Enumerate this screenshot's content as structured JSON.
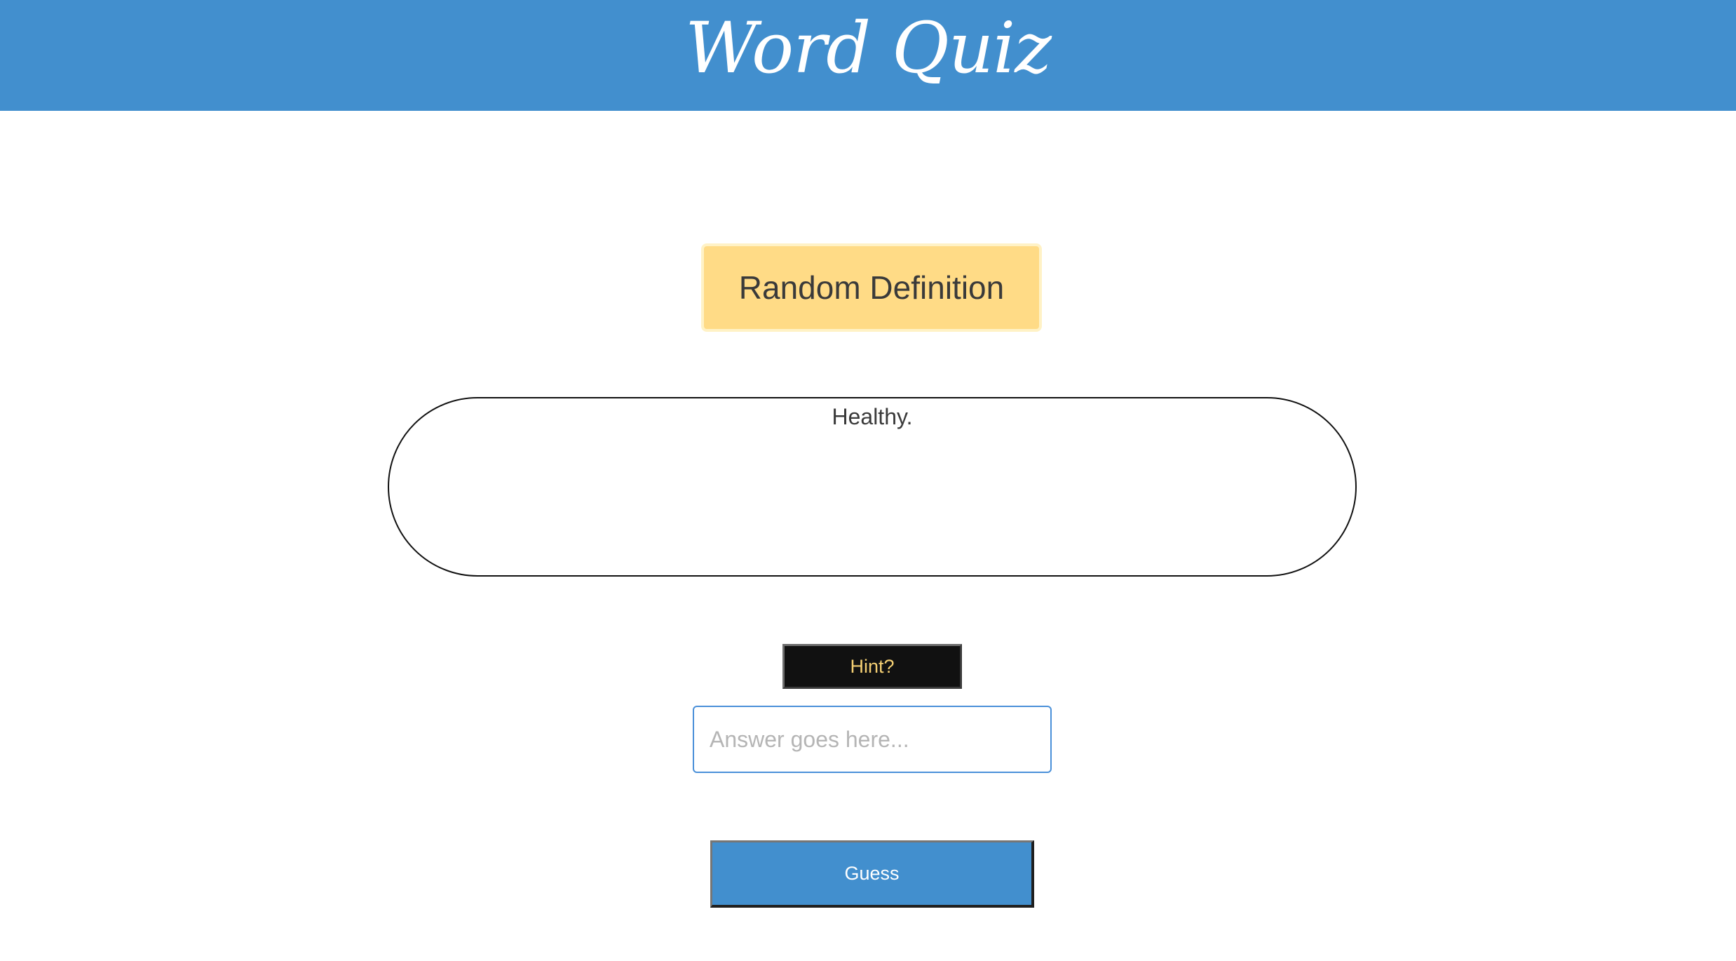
{
  "header": {
    "title": "Word Quiz"
  },
  "main": {
    "random_button_label": "Random Definition",
    "definition_text": "Healthy.",
    "hint_button_label": "Hint?",
    "answer_input": {
      "value": "",
      "placeholder": "Answer goes here..."
    },
    "guess_button_label": "Guess"
  },
  "colors": {
    "header_bg": "#428fce",
    "random_button_bg": "#ffdb86",
    "hint_button_bg": "#111111",
    "hint_button_text": "#f4cf73",
    "guess_button_bg": "#428fce",
    "input_border": "#4a90d9"
  }
}
